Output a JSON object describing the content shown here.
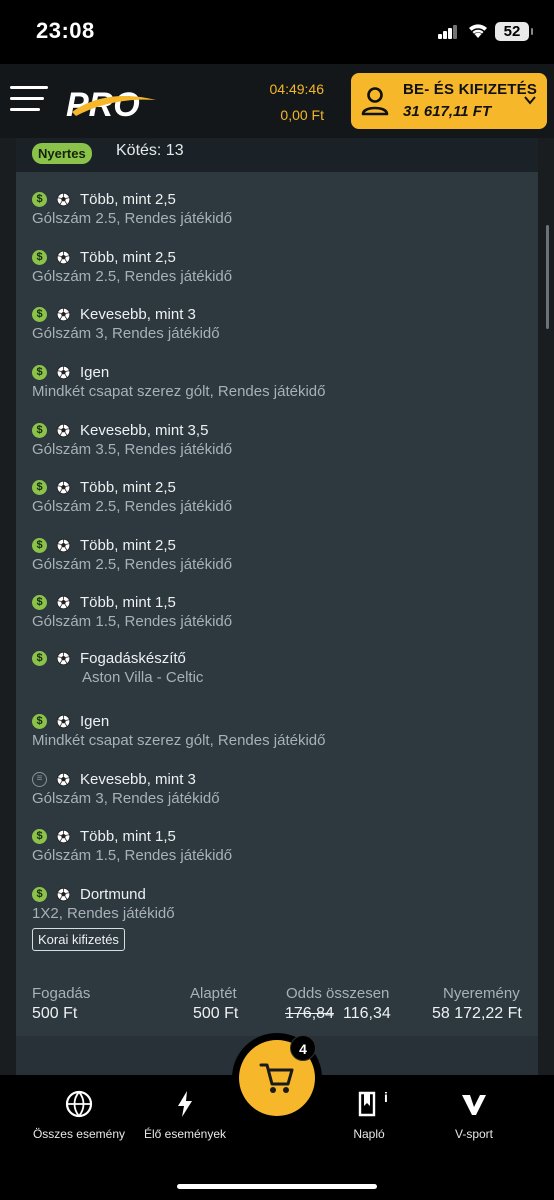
{
  "status_bar": {
    "time": "23:08",
    "battery": "52"
  },
  "header": {
    "logo_text": "PRO",
    "timer": "04:49:46",
    "balance": "0,00 Ft",
    "deposit_label": "BE- ÉS KIFIZETÉS",
    "deposit_amount": "31 617,11 FT"
  },
  "bet": {
    "badge": "Nyertes",
    "bet_id": "Kötés: 13",
    "selections": [
      {
        "name": "Több, mint 2,5",
        "sub": "Gólszám 2.5, Rendes játékidő",
        "status": "won"
      },
      {
        "name": "Több, mint 2,5",
        "sub": "Gólszám 2.5, Rendes játékidő",
        "status": "won"
      },
      {
        "name": "Kevesebb, mint 3",
        "sub": "Gólszám 3, Rendes játékidő",
        "status": "won"
      },
      {
        "name": "Igen",
        "sub": "Mindkét csapat szerez gólt, Rendes játékidő",
        "status": "won"
      },
      {
        "name": "Kevesebb, mint 3,5",
        "sub": "Gólszám 3.5, Rendes játékidő",
        "status": "won"
      },
      {
        "name": "Több, mint 2,5",
        "sub": "Gólszám 2.5, Rendes játékidő",
        "status": "won"
      },
      {
        "name": "Több, mint 2,5",
        "sub": "Gólszám 2.5, Rendes játékidő",
        "status": "won"
      },
      {
        "name": "Több, mint 1,5",
        "sub": "Gólszám 1.5, Rendes játékidő",
        "status": "won"
      },
      {
        "name": "Fogadáskészítő",
        "sub": "Aston Villa - Celtic",
        "status": "won"
      },
      {
        "name": "Igen",
        "sub": "Mindkét csapat szerez gólt, Rendes játékidő",
        "status": "won"
      },
      {
        "name": "Kevesebb, mint 3",
        "sub": "Gólszám 3, Rendes játékidő",
        "status": "pending"
      },
      {
        "name": "Több, mint 1,5",
        "sub": "Gólszám 1.5, Rendes játékidő",
        "status": "won"
      },
      {
        "name": "Dortmund",
        "sub": "1X2, Rendes játékidő",
        "status": "won"
      }
    ],
    "cashout_label": "Korai kifizetés",
    "summary": {
      "stake_label": "Fogadás",
      "stake_value": "500 Ft",
      "base_label": "Alaptét",
      "base_value": "500 Ft",
      "odds_label": "Odds összesen",
      "odds_old": "176,84",
      "odds_new": "116,34",
      "win_label": "Nyeremény",
      "win_value": "58 172,22 Ft"
    }
  },
  "bottom_nav": {
    "all_events": "Összes esemény",
    "live_events": "Élő események",
    "cart_count": "4",
    "journal": "Napló",
    "journal_badge": "i",
    "vsport": "V-sport"
  },
  "colors": {
    "accent": "#f6b72b",
    "won": "#8bc34a",
    "card_bg": "#2d383f"
  }
}
